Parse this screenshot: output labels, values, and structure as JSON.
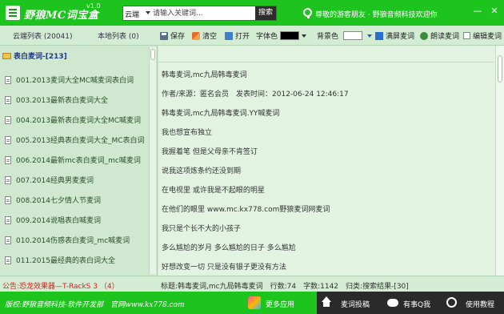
{
  "window": {
    "title": "野狼MC词宝盒",
    "version": "v1.0",
    "notice": "尊敬的游客朋友 · 野狼音频科技欢迎你"
  },
  "search": {
    "scope": "云端",
    "placeholder": "请输入关键词...",
    "button": "搜索"
  },
  "toolbar": {
    "cloud_tab": "云端列表 (20041)",
    "local_tab": "本地列表 (0)",
    "save": "保存",
    "clear": "清空",
    "open": "打开",
    "font_color_label": "字体色",
    "font_color": "#000000",
    "bg_color_label": "背景色",
    "bg_color": "#ffffff",
    "fullscreen": "满屏麦词",
    "read_aloud": "朗读麦词",
    "edit_lyrics": "编辑麦词"
  },
  "sidebar": {
    "category": "表白麦词-[213]",
    "items": [
      {
        "label": "001.2013麦词大全MC喊麦词表白词"
      },
      {
        "label": "003.2013最新表白麦词大全"
      },
      {
        "label": "004.2013最新表白麦词大全MC喊麦词"
      },
      {
        "label": "005.2013经典表白麦词大全_MC表白词"
      },
      {
        "label": "006.2014最新mc表白麦词_mc喊麦词"
      },
      {
        "label": "007.2014经典男麦麦词"
      },
      {
        "label": "008.2014七夕情人节麦词"
      },
      {
        "label": "009.2014说唱表白喊麦词"
      },
      {
        "label": "010.2014伤感表白麦词_mc喊麦词"
      },
      {
        "label": "011.2015最经典的表白词大全"
      }
    ]
  },
  "content": {
    "lines": [
      "韩毒麦词,mc九局韩毒麦词",
      "作者/来源：匿名会员　发表时间：2012-06-24 12:46:17",
      "韩毒麦词,mc九局韩毒麦词.YY喊麦词",
      "我也想宣布独立",
      "我握着笔 但是父母亲不肯签订",
      "说我这项炼条约还没到期",
      "在电视里 或许我是不起眼的明星",
      "在他们的眼里 www.mc.kx778.com野狼麦词网麦词",
      "我只是个长不大的小孩子",
      "多么尴尬的岁月 多么尴尬的日子 多么尴尬",
      "好想改变一切 只是没有银子更没有方法"
    ]
  },
  "status": {
    "ad": "公告:恐龙效果器—T-RackS 3 （4）",
    "info": "标题:韩毒麦词,mc九局韩毒麦词　行数:74　字数:1142　归类:搜索结果-[30]"
  },
  "footer": {
    "copyright": "版权:野狼音频科技-软件开发部　官网www.kx778.com",
    "more_apps": "更多应用",
    "submit": "麦词投稿",
    "qq": "有事Q我",
    "tutorial": "使用教程"
  }
}
